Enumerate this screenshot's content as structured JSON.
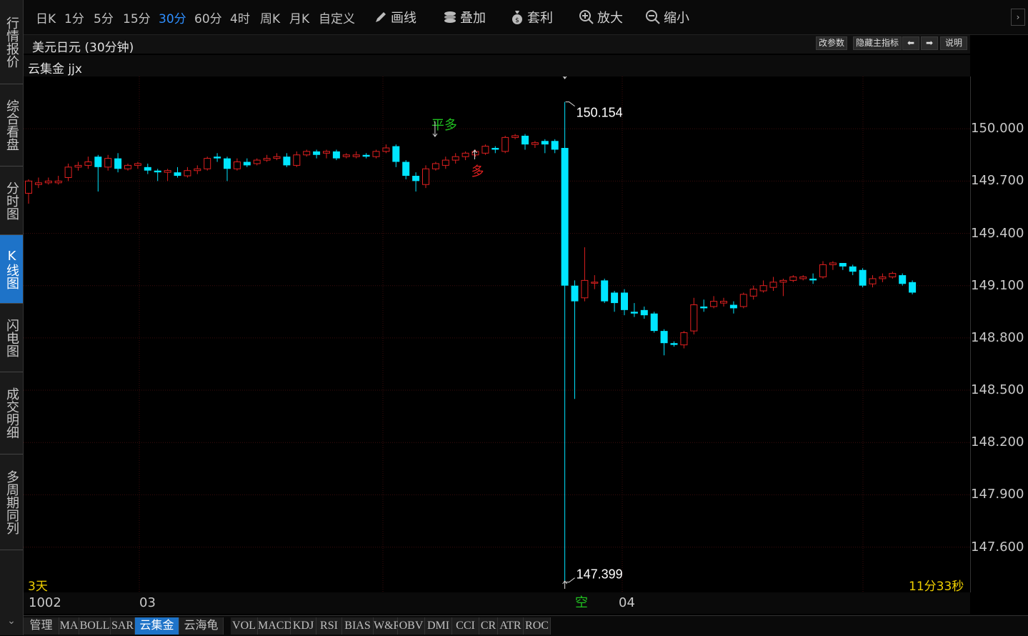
{
  "sidebar": {
    "tabs": [
      {
        "label": "行情报价",
        "active": false
      },
      {
        "label": "综合看盘",
        "active": false
      },
      {
        "label": "分时图",
        "active": false
      },
      {
        "label": "K线图",
        "active": true
      },
      {
        "label": "闪电图",
        "active": false
      },
      {
        "label": "成交明细",
        "active": false
      },
      {
        "label": "多周期同列",
        "active": false
      }
    ]
  },
  "toolbar": {
    "periods": [
      "日K",
      "1分",
      "5分",
      "15分",
      "30分",
      "60分",
      "4时",
      "周K",
      "月K",
      "自定义"
    ],
    "active_period": "30分",
    "tools": {
      "draw": "画线",
      "overlay": "叠加",
      "arbitrage": "套利",
      "zoom_in": "放大",
      "zoom_out": "缩小"
    },
    "collapse": "›"
  },
  "header": {
    "title": "美元日元 (30分钟)",
    "buttons": {
      "params": "改参数",
      "hide_indicator": "隐藏主指标",
      "left": "⬅",
      "right": "➡",
      "help": "说明"
    }
  },
  "indicator": {
    "name": "云集金 jjx"
  },
  "colors": {
    "up": "#e02020",
    "down": "#00e5ff",
    "signal_green": "#20c020",
    "signal_red": "#e02020",
    "grid": "#3a1010",
    "text_yellow": "#f0d000"
  },
  "annotations": {
    "high": "150.154",
    "low": "147.399",
    "signal1": "平多",
    "signal2": "平多",
    "signal3": "多",
    "signal4": "空"
  },
  "footer": {
    "range": "3天",
    "countdown": "11分33秒"
  },
  "bottom_tabs": [
    "管理",
    "MA",
    "BOLL",
    "SAR",
    "云集金",
    "云海龟",
    "VOL",
    "MACD",
    "KDJ",
    "RSI",
    "BIAS",
    "W&R",
    "OBV",
    "DMI",
    "CCI",
    "CR",
    "ATR",
    "ROC"
  ],
  "active_bottom_tab": "云集金",
  "chart_data": {
    "type": "candlestick",
    "title": "美元日元 (30分钟)",
    "y_ticks": [
      "150.000",
      "149.700",
      "149.400",
      "149.100",
      "148.800",
      "148.500",
      "148.200",
      "147.900",
      "147.600"
    ],
    "x_ticks": [
      "1002",
      "03",
      "04"
    ],
    "ylim": [
      147.34,
      150.3
    ],
    "candles": [
      [
        149.63,
        149.7,
        149.57,
        149.71
      ],
      [
        149.68,
        149.69,
        149.66,
        149.72
      ],
      [
        149.69,
        149.7,
        149.68,
        149.72
      ],
      [
        149.69,
        149.7,
        149.68,
        149.73
      ],
      [
        149.72,
        149.78,
        149.7,
        149.8
      ],
      [
        149.78,
        149.79,
        149.76,
        149.81
      ],
      [
        149.79,
        149.81,
        149.77,
        149.84
      ],
      [
        149.84,
        149.78,
        149.64,
        149.85
      ],
      [
        149.78,
        149.83,
        149.76,
        149.85
      ],
      [
        149.83,
        149.77,
        149.75,
        149.86
      ],
      [
        149.77,
        149.79,
        149.76,
        149.8
      ],
      [
        149.79,
        149.8,
        149.77,
        149.81
      ],
      [
        149.78,
        149.76,
        149.74,
        149.8
      ],
      [
        149.76,
        149.75,
        149.7,
        149.77
      ],
      [
        149.75,
        149.76,
        149.7,
        149.77
      ],
      [
        149.75,
        149.73,
        149.72,
        149.78
      ],
      [
        149.73,
        149.76,
        149.72,
        149.78
      ],
      [
        149.76,
        149.77,
        149.74,
        149.79
      ],
      [
        149.77,
        149.83,
        149.76,
        149.84
      ],
      [
        149.84,
        149.83,
        149.81,
        149.86
      ],
      [
        149.83,
        149.77,
        149.7,
        149.84
      ],
      [
        149.77,
        149.81,
        149.76,
        149.83
      ],
      [
        149.81,
        149.79,
        149.78,
        149.83
      ],
      [
        149.8,
        149.82,
        149.79,
        149.83
      ],
      [
        149.82,
        149.83,
        149.81,
        149.85
      ],
      [
        149.83,
        149.84,
        149.82,
        149.86
      ],
      [
        149.84,
        149.79,
        149.78,
        149.86
      ],
      [
        149.79,
        149.85,
        149.78,
        149.87
      ],
      [
        149.85,
        149.87,
        149.84,
        149.88
      ],
      [
        149.87,
        149.85,
        149.83,
        149.88
      ],
      [
        149.86,
        149.87,
        149.83,
        149.88
      ],
      [
        149.87,
        149.83,
        149.82,
        149.88
      ],
      [
        149.84,
        149.85,
        149.83,
        149.86
      ],
      [
        149.84,
        149.85,
        149.83,
        149.87
      ],
      [
        149.85,
        149.84,
        149.83,
        149.86
      ],
      [
        149.84,
        149.87,
        149.83,
        149.88
      ],
      [
        149.87,
        149.89,
        149.86,
        149.91
      ],
      [
        149.9,
        149.81,
        149.78,
        149.91
      ],
      [
        149.81,
        149.73,
        149.71,
        149.82
      ],
      [
        149.73,
        149.7,
        149.64,
        149.75
      ],
      [
        149.68,
        149.77,
        149.66,
        149.79
      ],
      [
        149.77,
        149.8,
        149.76,
        149.81
      ],
      [
        149.79,
        149.82,
        149.77,
        149.84
      ],
      [
        149.82,
        149.84,
        149.8,
        149.86
      ],
      [
        149.84,
        149.86,
        149.82,
        149.87
      ],
      [
        149.85,
        149.87,
        149.84,
        149.88
      ],
      [
        149.86,
        149.9,
        149.85,
        149.91
      ],
      [
        149.89,
        149.88,
        149.86,
        149.9
      ],
      [
        149.87,
        149.95,
        149.86,
        149.96
      ],
      [
        149.95,
        149.96,
        149.94,
        149.97
      ],
      [
        149.96,
        149.91,
        149.88,
        149.97
      ],
      [
        149.91,
        149.92,
        149.89,
        149.93
      ],
      [
        149.93,
        149.91,
        149.86,
        149.94
      ],
      [
        149.93,
        149.88,
        149.86,
        149.94
      ],
      [
        149.89,
        149.1,
        147.399,
        150.154
      ],
      [
        149.1,
        149.01,
        148.45,
        149.13
      ],
      [
        149.03,
        149.13,
        149.01,
        149.32
      ],
      [
        149.12,
        149.12,
        149.08,
        149.16
      ],
      [
        149.13,
        149.01,
        149.0,
        149.14
      ],
      [
        149.06,
        149.0,
        148.95,
        149.07
      ],
      [
        149.06,
        148.96,
        148.93,
        149.08
      ],
      [
        148.95,
        148.94,
        148.92,
        149.0
      ],
      [
        148.96,
        148.93,
        148.91,
        148.98
      ],
      [
        148.94,
        148.84,
        148.83,
        148.95
      ],
      [
        148.84,
        148.77,
        148.7,
        148.85
      ],
      [
        148.77,
        148.76,
        148.75,
        148.78
      ],
      [
        148.76,
        148.83,
        148.74,
        148.84
      ],
      [
        148.84,
        148.99,
        148.82,
        149.03
      ],
      [
        148.98,
        148.97,
        148.95,
        149.02
      ],
      [
        148.98,
        149.01,
        148.97,
        149.04
      ],
      [
        149.0,
        149.01,
        148.98,
        149.03
      ],
      [
        148.99,
        148.97,
        148.94,
        149.01
      ],
      [
        148.98,
        149.05,
        148.97,
        149.06
      ],
      [
        149.04,
        149.08,
        149.02,
        149.1
      ],
      [
        149.07,
        149.1,
        149.06,
        149.13
      ],
      [
        149.09,
        149.12,
        149.07,
        149.15
      ],
      [
        149.12,
        149.13,
        149.04,
        149.14
      ],
      [
        149.13,
        149.15,
        149.12,
        149.16
      ],
      [
        149.14,
        149.15,
        149.13,
        149.16
      ],
      [
        149.14,
        149.13,
        149.11,
        149.17
      ],
      [
        149.15,
        149.22,
        149.14,
        149.24
      ],
      [
        149.22,
        149.23,
        149.19,
        149.24
      ],
      [
        149.23,
        149.21,
        149.19,
        149.23
      ],
      [
        149.21,
        149.18,
        149.16,
        149.22
      ],
      [
        149.19,
        149.1,
        149.09,
        149.2
      ],
      [
        149.11,
        149.14,
        149.09,
        149.16
      ],
      [
        149.14,
        149.15,
        149.12,
        149.17
      ],
      [
        149.15,
        149.17,
        149.14,
        149.18
      ],
      [
        149.16,
        149.11,
        149.1,
        149.17
      ],
      [
        149.12,
        149.06,
        149.05,
        149.13
      ]
    ]
  }
}
